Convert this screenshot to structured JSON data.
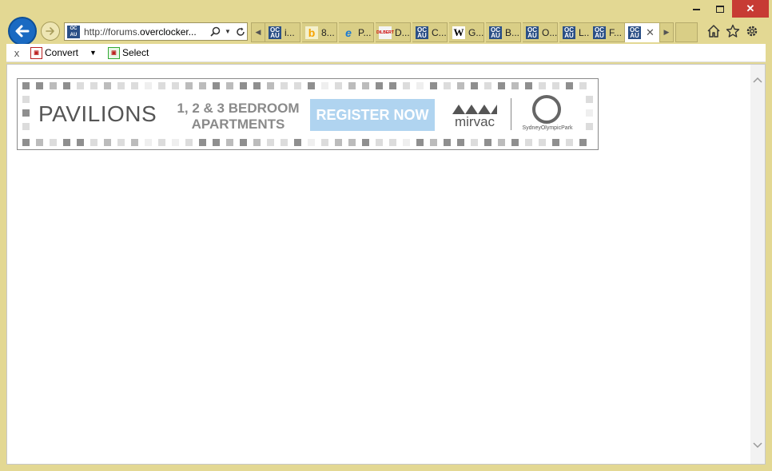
{
  "browser": {
    "address": {
      "url_prefix": "http://forums.",
      "url_domain": "overclocker...",
      "site_icon": "OC AU"
    },
    "tabs": [
      {
        "label": "i...",
        "favicon": "OC AU"
      },
      {
        "label": "8...",
        "favicon": "b"
      },
      {
        "label": "P...",
        "favicon": "e"
      },
      {
        "label": "D...",
        "favicon": "DILBERT"
      },
      {
        "label": "C...",
        "favicon": "OC AU"
      },
      {
        "label": "G...",
        "favicon": "W"
      },
      {
        "label": "B...",
        "favicon": "OC AU"
      },
      {
        "label": "O...",
        "favicon": "OC AU"
      },
      {
        "label": "L...",
        "favicon": "OC AU"
      },
      {
        "label": "F...",
        "favicon": "OC AU"
      },
      {
        "label": "",
        "favicon": "OC AU"
      }
    ],
    "active_tab_close": "✕"
  },
  "command_bar": {
    "close_label": "x",
    "convert_label": "Convert",
    "select_label": "Select"
  },
  "banner": {
    "title": "PAVILIONS",
    "subtitle_line1": "1, 2 & 3 BEDROOM",
    "subtitle_line2": "APARTMENTS",
    "cta": "REGISTER NOW",
    "brand": "mirvac",
    "partner": "SydneyOlympicPark"
  }
}
